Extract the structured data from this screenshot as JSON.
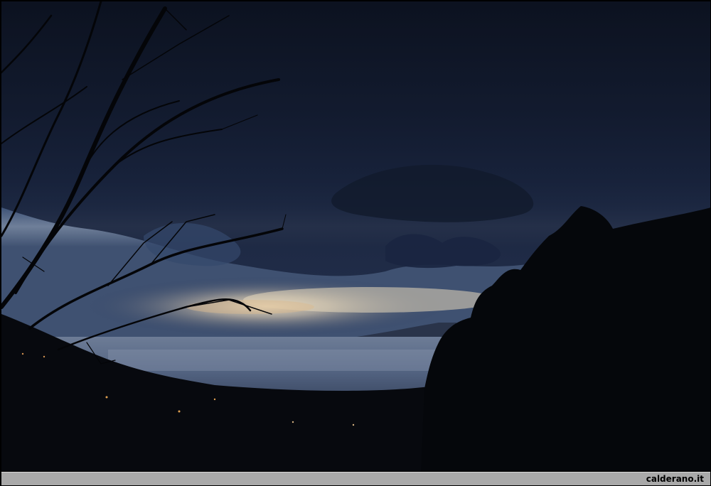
{
  "watermark": {
    "text": "calderano.it"
  },
  "colors": {
    "sky_top": "#0d1423",
    "sky_mid": "#1e2c4a",
    "horizon_glow": "#e9dcc3",
    "sea": "#5f6f88",
    "foreground": "#06080c",
    "caption_bar": "#a9a9a9"
  }
}
